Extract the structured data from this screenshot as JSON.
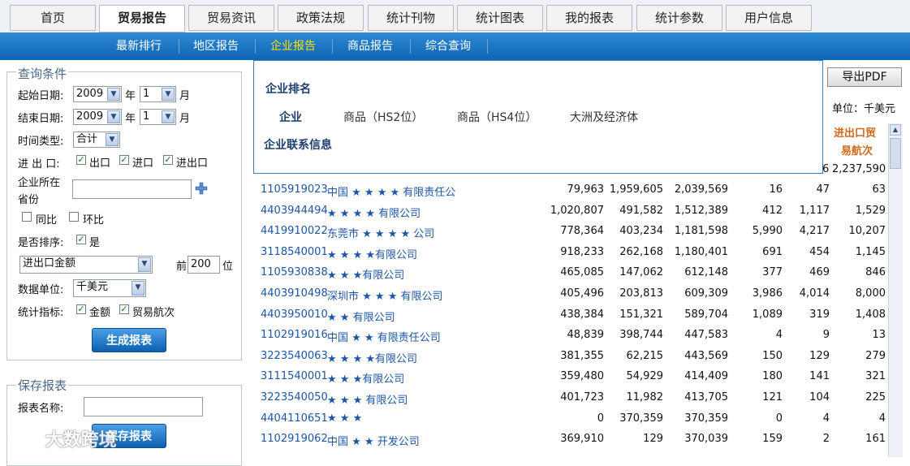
{
  "topnav": {
    "tabs": [
      "首页",
      "贸易报告",
      "贸易资讯",
      "政策法规",
      "统计刊物",
      "统计图表",
      "我的报表",
      "统计参数",
      "用户信息"
    ],
    "active": "贸易报告"
  },
  "subnav": {
    "tabs": [
      "最新排行",
      "地区报告",
      "企业报告",
      "商品报告",
      "综合查询"
    ],
    "active": "企业报告"
  },
  "query": {
    "title": "查询条件",
    "start_label": "起始日期:",
    "end_label": "结束日期:",
    "start_year": "2009",
    "start_month": "1",
    "end_year": "2009",
    "end_month": "1",
    "year_unit": "年",
    "month_unit": "月",
    "time_type_label": "时间类型:",
    "time_type": "合计",
    "io_label": "进 出 口:",
    "io_export": "出口",
    "io_import": "进口",
    "io_both": "进出口",
    "province_label_1": "企业所在",
    "province_label_2": "省份",
    "yoy": "同比",
    "mom": "环比",
    "sort_label": "是否排序:",
    "sort_yes": "是",
    "sort_field": "进出口金额",
    "top_prefix": "前",
    "top_n": "200",
    "top_suffix": "位",
    "unit_label": "数据单位:",
    "unit_value": "千美元",
    "indicator_label": "统计指标:",
    "ind_amount": "金额",
    "ind_voyages": "贸易航次",
    "generate_button": "生成报表"
  },
  "save": {
    "title": "保存报表",
    "name_label": "报表名称:",
    "name_value": "",
    "save_button": "保存报表"
  },
  "dropdown": {
    "section1": "企业排名",
    "items": [
      "企业",
      "商品（HS2位）",
      "商品（HS4位）",
      "大洲及经济体"
    ],
    "section2": "企业联系信息"
  },
  "right": {
    "pdf_button": "导出PDF",
    "unit": "单位：千美元",
    "col_header_1": "进出口贸",
    "col_header_2": "易航次",
    "partial_row_digit": "6",
    "partial_row_value": "2,237,590"
  },
  "table": {
    "rows": [
      {
        "code": "1105919023",
        "name": "中国 ★ ★ ★ ★  有限责任公",
        "export": "79,963",
        "import": "1,959,605",
        "total": "2,039,569",
        "ev": "16",
        "iv": "47",
        "tv": "63"
      },
      {
        "code": "4403944494",
        "name": "  ★ ★ ★ ★  有限公司",
        "export": "1,020,807",
        "import": "491,582",
        "total": "1,512,389",
        "ev": "412",
        "iv": "1,117",
        "tv": "1,529"
      },
      {
        "code": "4419910022",
        "name": "东莞市 ★ ★ ★ ★  公司",
        "export": "778,364",
        "import": "403,234",
        "total": "1,181,598",
        "ev": "5,990",
        "iv": "4,217",
        "tv": "10,207"
      },
      {
        "code": "3118540001",
        "name": "★ ★ ★ ★有限公司",
        "export": "918,233",
        "import": "262,168",
        "total": "1,180,401",
        "ev": "691",
        "iv": "454",
        "tv": "1,145"
      },
      {
        "code": "1105930838",
        "name": "★ ★ ★有限公司",
        "export": "465,085",
        "import": "147,062",
        "total": "612,148",
        "ev": "377",
        "iv": "469",
        "tv": "846"
      },
      {
        "code": "4403910498",
        "name": "深圳市 ★ ★ ★  有限公司",
        "export": "405,496",
        "import": "203,813",
        "total": "609,309",
        "ev": "3,986",
        "iv": "4,014",
        "tv": "8,000"
      },
      {
        "code": "4403950010",
        "name": " ★ ★ 有限公司",
        "export": "438,384",
        "import": "151,321",
        "total": "589,704",
        "ev": "1,089",
        "iv": "319",
        "tv": "1,408"
      },
      {
        "code": "1102919016",
        "name": "中国 ★ ★ 有限责任公司",
        "export": "48,839",
        "import": "398,744",
        "total": "447,583",
        "ev": "4",
        "iv": "9",
        "tv": "13"
      },
      {
        "code": "3223540063",
        "name": "★ ★ ★ ★有限公司",
        "export": "381,355",
        "import": "62,215",
        "total": "443,569",
        "ev": "150",
        "iv": "129",
        "tv": "279"
      },
      {
        "code": "3111540001",
        "name": "★ ★ ★有限公司",
        "export": "359,480",
        "import": "54,929",
        "total": "414,409",
        "ev": "180",
        "iv": "141",
        "tv": "321"
      },
      {
        "code": "3223540050",
        "name": "★ ★ ★  有限公司",
        "export": "401,723",
        "import": "11,982",
        "total": "413,705",
        "ev": "121",
        "iv": "104",
        "tv": "225"
      },
      {
        "code": "4404110651",
        "name": "★ ★ ★",
        "export": "0",
        "import": "370,359",
        "total": "370,359",
        "ev": "0",
        "iv": "4",
        "tv": "4"
      },
      {
        "code": "1102919062",
        "name": "中国 ★ ★  开发公司",
        "export": "369,910",
        "import": "129",
        "total": "370,039",
        "ev": "159",
        "iv": "2",
        "tv": "161"
      }
    ]
  },
  "watermark": "大数跨境"
}
